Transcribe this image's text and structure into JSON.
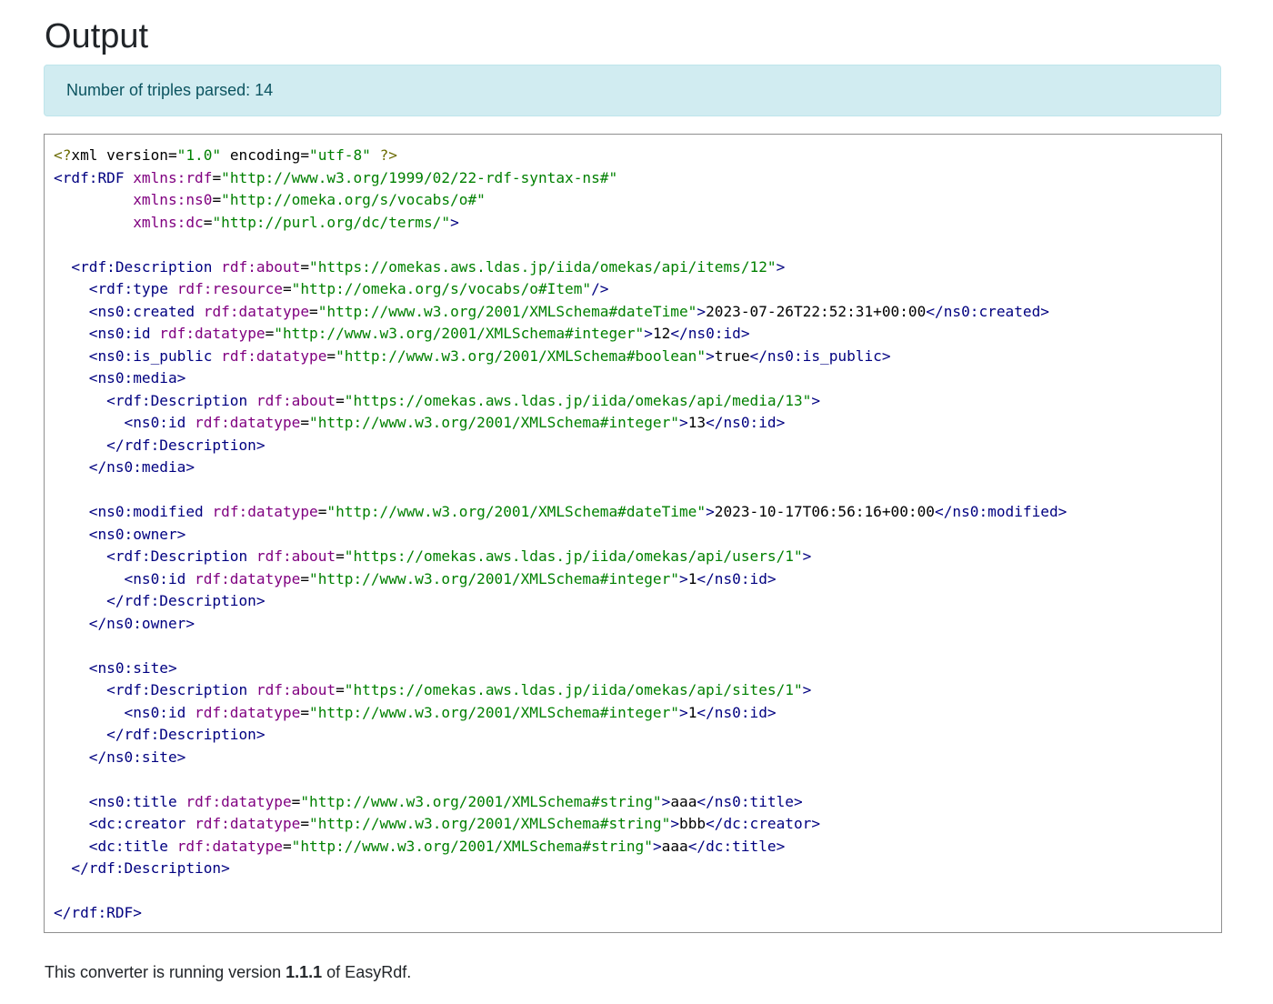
{
  "page": {
    "title": "Output"
  },
  "alert": {
    "text": "Number of triples parsed: 14"
  },
  "code": {
    "lines": [
      [
        [
          "pi",
          "<?"
        ],
        [
          "txt",
          "xml version="
        ],
        [
          "val",
          "\"1.0\""
        ],
        [
          "txt",
          " encoding="
        ],
        [
          "val",
          "\"utf-8\""
        ],
        [
          "txt",
          " "
        ],
        [
          "pi",
          "?>"
        ]
      ],
      [
        [
          "tag",
          "<rdf:RDF"
        ],
        [
          "txt",
          " "
        ],
        [
          "attr",
          "xmlns:rdf"
        ],
        [
          "txt",
          "="
        ],
        [
          "val",
          "\"http://www.w3.org/1999/02/22-rdf-syntax-ns#\""
        ]
      ],
      [
        [
          "txt",
          "         "
        ],
        [
          "attr",
          "xmlns:ns0"
        ],
        [
          "txt",
          "="
        ],
        [
          "val",
          "\"http://omeka.org/s/vocabs/o#\""
        ]
      ],
      [
        [
          "txt",
          "         "
        ],
        [
          "attr",
          "xmlns:dc"
        ],
        [
          "txt",
          "="
        ],
        [
          "val",
          "\"http://purl.org/dc/terms/\""
        ],
        [
          "tag",
          ">"
        ]
      ],
      [],
      [
        [
          "txt",
          "  "
        ],
        [
          "tag",
          "<rdf:Description"
        ],
        [
          "txt",
          " "
        ],
        [
          "attr",
          "rdf:about"
        ],
        [
          "txt",
          "="
        ],
        [
          "val",
          "\"https://omekas.aws.ldas.jp/iida/omekas/api/items/12\""
        ],
        [
          "tag",
          ">"
        ]
      ],
      [
        [
          "txt",
          "    "
        ],
        [
          "tag",
          "<rdf:type"
        ],
        [
          "txt",
          " "
        ],
        [
          "attr",
          "rdf:resource"
        ],
        [
          "txt",
          "="
        ],
        [
          "val",
          "\"http://omeka.org/s/vocabs/o#Item\""
        ],
        [
          "tag",
          "/>"
        ]
      ],
      [
        [
          "txt",
          "    "
        ],
        [
          "tag",
          "<ns0:created"
        ],
        [
          "txt",
          " "
        ],
        [
          "attr",
          "rdf:datatype"
        ],
        [
          "txt",
          "="
        ],
        [
          "val",
          "\"http://www.w3.org/2001/XMLSchema#dateTime\""
        ],
        [
          "tag",
          ">"
        ],
        [
          "txt",
          "2023-07-26T22:52:31+00:00"
        ],
        [
          "tag",
          "</ns0:created>"
        ]
      ],
      [
        [
          "txt",
          "    "
        ],
        [
          "tag",
          "<ns0:id"
        ],
        [
          "txt",
          " "
        ],
        [
          "attr",
          "rdf:datatype"
        ],
        [
          "txt",
          "="
        ],
        [
          "val",
          "\"http://www.w3.org/2001/XMLSchema#integer\""
        ],
        [
          "tag",
          ">"
        ],
        [
          "txt",
          "12"
        ],
        [
          "tag",
          "</ns0:id>"
        ]
      ],
      [
        [
          "txt",
          "    "
        ],
        [
          "tag",
          "<ns0:is_public"
        ],
        [
          "txt",
          " "
        ],
        [
          "attr",
          "rdf:datatype"
        ],
        [
          "txt",
          "="
        ],
        [
          "val",
          "\"http://www.w3.org/2001/XMLSchema#boolean\""
        ],
        [
          "tag",
          ">"
        ],
        [
          "txt",
          "true"
        ],
        [
          "tag",
          "</ns0:is_public>"
        ]
      ],
      [
        [
          "txt",
          "    "
        ],
        [
          "tag",
          "<ns0:media>"
        ]
      ],
      [
        [
          "txt",
          "      "
        ],
        [
          "tag",
          "<rdf:Description"
        ],
        [
          "txt",
          " "
        ],
        [
          "attr",
          "rdf:about"
        ],
        [
          "txt",
          "="
        ],
        [
          "val",
          "\"https://omekas.aws.ldas.jp/iida/omekas/api/media/13\""
        ],
        [
          "tag",
          ">"
        ]
      ],
      [
        [
          "txt",
          "        "
        ],
        [
          "tag",
          "<ns0:id"
        ],
        [
          "txt",
          " "
        ],
        [
          "attr",
          "rdf:datatype"
        ],
        [
          "txt",
          "="
        ],
        [
          "val",
          "\"http://www.w3.org/2001/XMLSchema#integer\""
        ],
        [
          "tag",
          ">"
        ],
        [
          "txt",
          "13"
        ],
        [
          "tag",
          "</ns0:id>"
        ]
      ],
      [
        [
          "txt",
          "      "
        ],
        [
          "tag",
          "</rdf:Description>"
        ]
      ],
      [
        [
          "txt",
          "    "
        ],
        [
          "tag",
          "</ns0:media>"
        ]
      ],
      [],
      [
        [
          "txt",
          "    "
        ],
        [
          "tag",
          "<ns0:modified"
        ],
        [
          "txt",
          " "
        ],
        [
          "attr",
          "rdf:datatype"
        ],
        [
          "txt",
          "="
        ],
        [
          "val",
          "\"http://www.w3.org/2001/XMLSchema#dateTime\""
        ],
        [
          "tag",
          ">"
        ],
        [
          "txt",
          "2023-10-17T06:56:16+00:00"
        ],
        [
          "tag",
          "</ns0:modified>"
        ]
      ],
      [
        [
          "txt",
          "    "
        ],
        [
          "tag",
          "<ns0:owner>"
        ]
      ],
      [
        [
          "txt",
          "      "
        ],
        [
          "tag",
          "<rdf:Description"
        ],
        [
          "txt",
          " "
        ],
        [
          "attr",
          "rdf:about"
        ],
        [
          "txt",
          "="
        ],
        [
          "val",
          "\"https://omekas.aws.ldas.jp/iida/omekas/api/users/1\""
        ],
        [
          "tag",
          ">"
        ]
      ],
      [
        [
          "txt",
          "        "
        ],
        [
          "tag",
          "<ns0:id"
        ],
        [
          "txt",
          " "
        ],
        [
          "attr",
          "rdf:datatype"
        ],
        [
          "txt",
          "="
        ],
        [
          "val",
          "\"http://www.w3.org/2001/XMLSchema#integer\""
        ],
        [
          "tag",
          ">"
        ],
        [
          "txt",
          "1"
        ],
        [
          "tag",
          "</ns0:id>"
        ]
      ],
      [
        [
          "txt",
          "      "
        ],
        [
          "tag",
          "</rdf:Description>"
        ]
      ],
      [
        [
          "txt",
          "    "
        ],
        [
          "tag",
          "</ns0:owner>"
        ]
      ],
      [],
      [
        [
          "txt",
          "    "
        ],
        [
          "tag",
          "<ns0:site>"
        ]
      ],
      [
        [
          "txt",
          "      "
        ],
        [
          "tag",
          "<rdf:Description"
        ],
        [
          "txt",
          " "
        ],
        [
          "attr",
          "rdf:about"
        ],
        [
          "txt",
          "="
        ],
        [
          "val",
          "\"https://omekas.aws.ldas.jp/iida/omekas/api/sites/1\""
        ],
        [
          "tag",
          ">"
        ]
      ],
      [
        [
          "txt",
          "        "
        ],
        [
          "tag",
          "<ns0:id"
        ],
        [
          "txt",
          " "
        ],
        [
          "attr",
          "rdf:datatype"
        ],
        [
          "txt",
          "="
        ],
        [
          "val",
          "\"http://www.w3.org/2001/XMLSchema#integer\""
        ],
        [
          "tag",
          ">"
        ],
        [
          "txt",
          "1"
        ],
        [
          "tag",
          "</ns0:id>"
        ]
      ],
      [
        [
          "txt",
          "      "
        ],
        [
          "tag",
          "</rdf:Description>"
        ]
      ],
      [
        [
          "txt",
          "    "
        ],
        [
          "tag",
          "</ns0:site>"
        ]
      ],
      [],
      [
        [
          "txt",
          "    "
        ],
        [
          "tag",
          "<ns0:title"
        ],
        [
          "txt",
          " "
        ],
        [
          "attr",
          "rdf:datatype"
        ],
        [
          "txt",
          "="
        ],
        [
          "val",
          "\"http://www.w3.org/2001/XMLSchema#string\""
        ],
        [
          "tag",
          ">"
        ],
        [
          "txt",
          "aaa"
        ],
        [
          "tag",
          "</ns0:title>"
        ]
      ],
      [
        [
          "txt",
          "    "
        ],
        [
          "tag",
          "<dc:creator"
        ],
        [
          "txt",
          " "
        ],
        [
          "attr",
          "rdf:datatype"
        ],
        [
          "txt",
          "="
        ],
        [
          "val",
          "\"http://www.w3.org/2001/XMLSchema#string\""
        ],
        [
          "tag",
          ">"
        ],
        [
          "txt",
          "bbb"
        ],
        [
          "tag",
          "</dc:creator>"
        ]
      ],
      [
        [
          "txt",
          "    "
        ],
        [
          "tag",
          "<dc:title"
        ],
        [
          "txt",
          " "
        ],
        [
          "attr",
          "rdf:datatype"
        ],
        [
          "txt",
          "="
        ],
        [
          "val",
          "\"http://www.w3.org/2001/XMLSchema#string\""
        ],
        [
          "tag",
          ">"
        ],
        [
          "txt",
          "aaa"
        ],
        [
          "tag",
          "</dc:title>"
        ]
      ],
      [
        [
          "txt",
          "  "
        ],
        [
          "tag",
          "</rdf:Description>"
        ]
      ],
      [],
      [
        [
          "tag",
          "</rdf:RDF>"
        ]
      ]
    ]
  },
  "footer": {
    "prefix": "This converter is running version ",
    "version": "1.1.1",
    "suffix": " of EasyRdf."
  },
  "colors": {
    "alert_bg": "#d1ecf1",
    "alert_text": "#0c5460",
    "tag": "#000080",
    "attribute": "#800080",
    "value": "#008000",
    "processing_instruction": "#6b6b00"
  }
}
